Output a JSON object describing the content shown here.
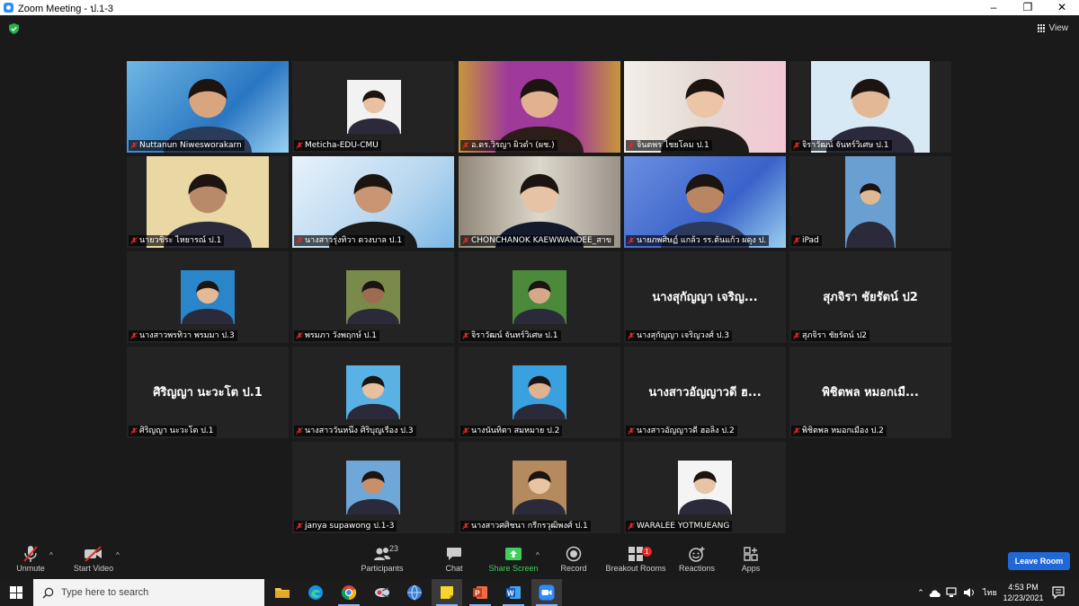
{
  "window": {
    "title": "Zoom Meeting - ป.1-3",
    "minimize": "–",
    "maximize": "❐",
    "close": "✕"
  },
  "view_label": "View",
  "colors": {
    "accent": "#2d8cff",
    "active_speaker": "#c8d33a",
    "leave": "#1f68d5",
    "share": "#3fcf5a",
    "muted": "#e02828"
  },
  "tiles": [
    {
      "name": "Nuttanun Niwesworakarn",
      "overlay": ""
    },
    {
      "name": "Meticha-EDU-CMU",
      "overlay": ""
    },
    {
      "name": "อ.ดร.วิรญา ผิวดำ (ผช.)",
      "overlay": ""
    },
    {
      "name": "จินตพร ไชยโคม ป.1",
      "overlay": ""
    },
    {
      "name": "จิราวัฒน์ จันทร์วิเศษ ป.1",
      "overlay": ""
    },
    {
      "name": "นายวชิระ ไหยารณ์ ป.1",
      "overlay": ""
    },
    {
      "name": "นางสาวรุ่งทิวา ดวงบาล ป.1",
      "overlay": ""
    },
    {
      "name": "CHONCHANOK KAEWWANDEE_สาข",
      "overlay": ""
    },
    {
      "name": "นายภพศิษฏ์ แกล้ว รร.ต้นแก้ว ผดุง ป.",
      "overlay": ""
    },
    {
      "name": "iPad",
      "overlay": ""
    },
    {
      "name": "นางสาวพรทิวา พรมมา ป.3",
      "overlay": ""
    },
    {
      "name": "พรมภา วังพฤกษ์ ป.1",
      "overlay": ""
    },
    {
      "name": "จิราวัฒน์ จันทร์วิเศษ ป.1",
      "overlay": ""
    },
    {
      "name": "นางสุกัญญา เจริญวงศ์ ป.3",
      "overlay": "นางสุกัญญา เจริญ..."
    },
    {
      "name": "สุภจิรา ชัยรัตน์ ป2",
      "overlay": "สุภจิรา ชัยรัตน์ ป2"
    },
    {
      "name": "ศิริญญา นะวะโต ป.1",
      "overlay": "ศิริญญา นะวะโต ป.1"
    },
    {
      "name": "นางสาววันหนึ่ง ศิริบุญเรือง ป.3",
      "overlay": ""
    },
    {
      "name": "นางนันทิตา สมหมาย ป.2",
      "overlay": ""
    },
    {
      "name": "นางสาวอัญญาวดี ฮอลิ่ง ป.2",
      "overlay": "นางสาวอัญญาวดี ฮ..."
    },
    {
      "name": "พิชิตพล หมอกเมือง ป.2",
      "overlay": "พิชิตพล หมอกเมื..."
    },
    {
      "name": "janya supawong ป.1-3",
      "overlay": ""
    },
    {
      "name": "นางสาวศศิชนา กรีกรวุฒิพงศ์ ป.1",
      "overlay": ""
    },
    {
      "name": "WARALEE YOTMUEANG",
      "overlay": ""
    }
  ],
  "toolbar": {
    "unmute": "Unmute",
    "start_video": "Start Video",
    "participants": "Participants",
    "participants_count": "23",
    "chat": "Chat",
    "share_screen": "Share Screen",
    "record": "Record",
    "breakout_rooms": "Breakout Rooms",
    "breakout_badge": "1",
    "reactions": "Reactions",
    "apps": "Apps",
    "leave_room": "Leave Room"
  },
  "taskbar": {
    "search_placeholder": "Type here to search",
    "input_language": "ไทย",
    "time": "4:53 PM",
    "date": "12/23/2021"
  }
}
